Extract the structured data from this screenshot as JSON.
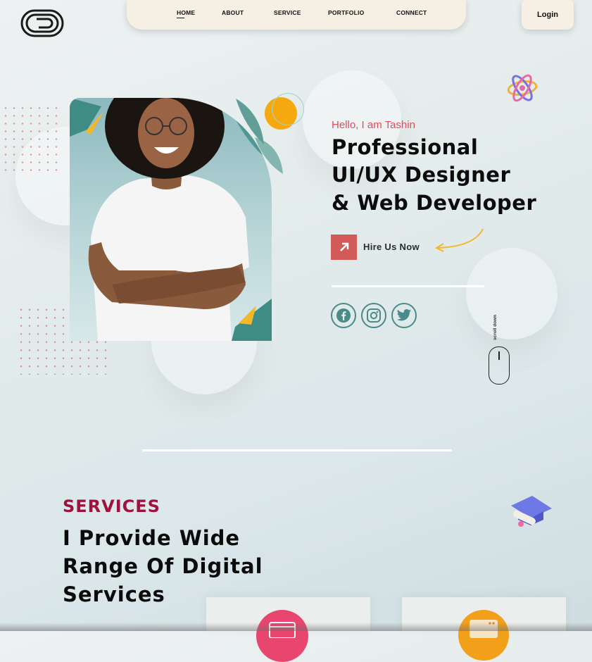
{
  "nav": {
    "items": [
      {
        "label": "HOME",
        "active": true
      },
      {
        "label": "ABOUT",
        "active": false
      },
      {
        "label": "SERVICE",
        "active": false
      },
      {
        "label": "PORTFOLIO",
        "active": false
      },
      {
        "label": "CONNECT",
        "active": false
      }
    ],
    "login_label": "Login"
  },
  "hero": {
    "greeting": "Hello, I am Tashin",
    "headline_lines": [
      "Professional",
      "UI/UX Designer",
      "& Web Developer"
    ],
    "cta_label": "Hire Us Now",
    "social_icons": [
      "facebook-icon",
      "instagram-icon",
      "twitter-icon"
    ],
    "scroll_label": "scroll down"
  },
  "services": {
    "eyebrow": "SERVICES",
    "heading_lines": [
      "I Provide Wide",
      "Range Of Digital",
      "Services"
    ]
  },
  "colors": {
    "accent_red": "#e44a5c",
    "services_maroon": "#a0123e",
    "teal": "#4a8a88",
    "cta_block": "#d25b58",
    "arrow_yellow": "#f3b72a",
    "nav_bg": "#f6efe3"
  }
}
